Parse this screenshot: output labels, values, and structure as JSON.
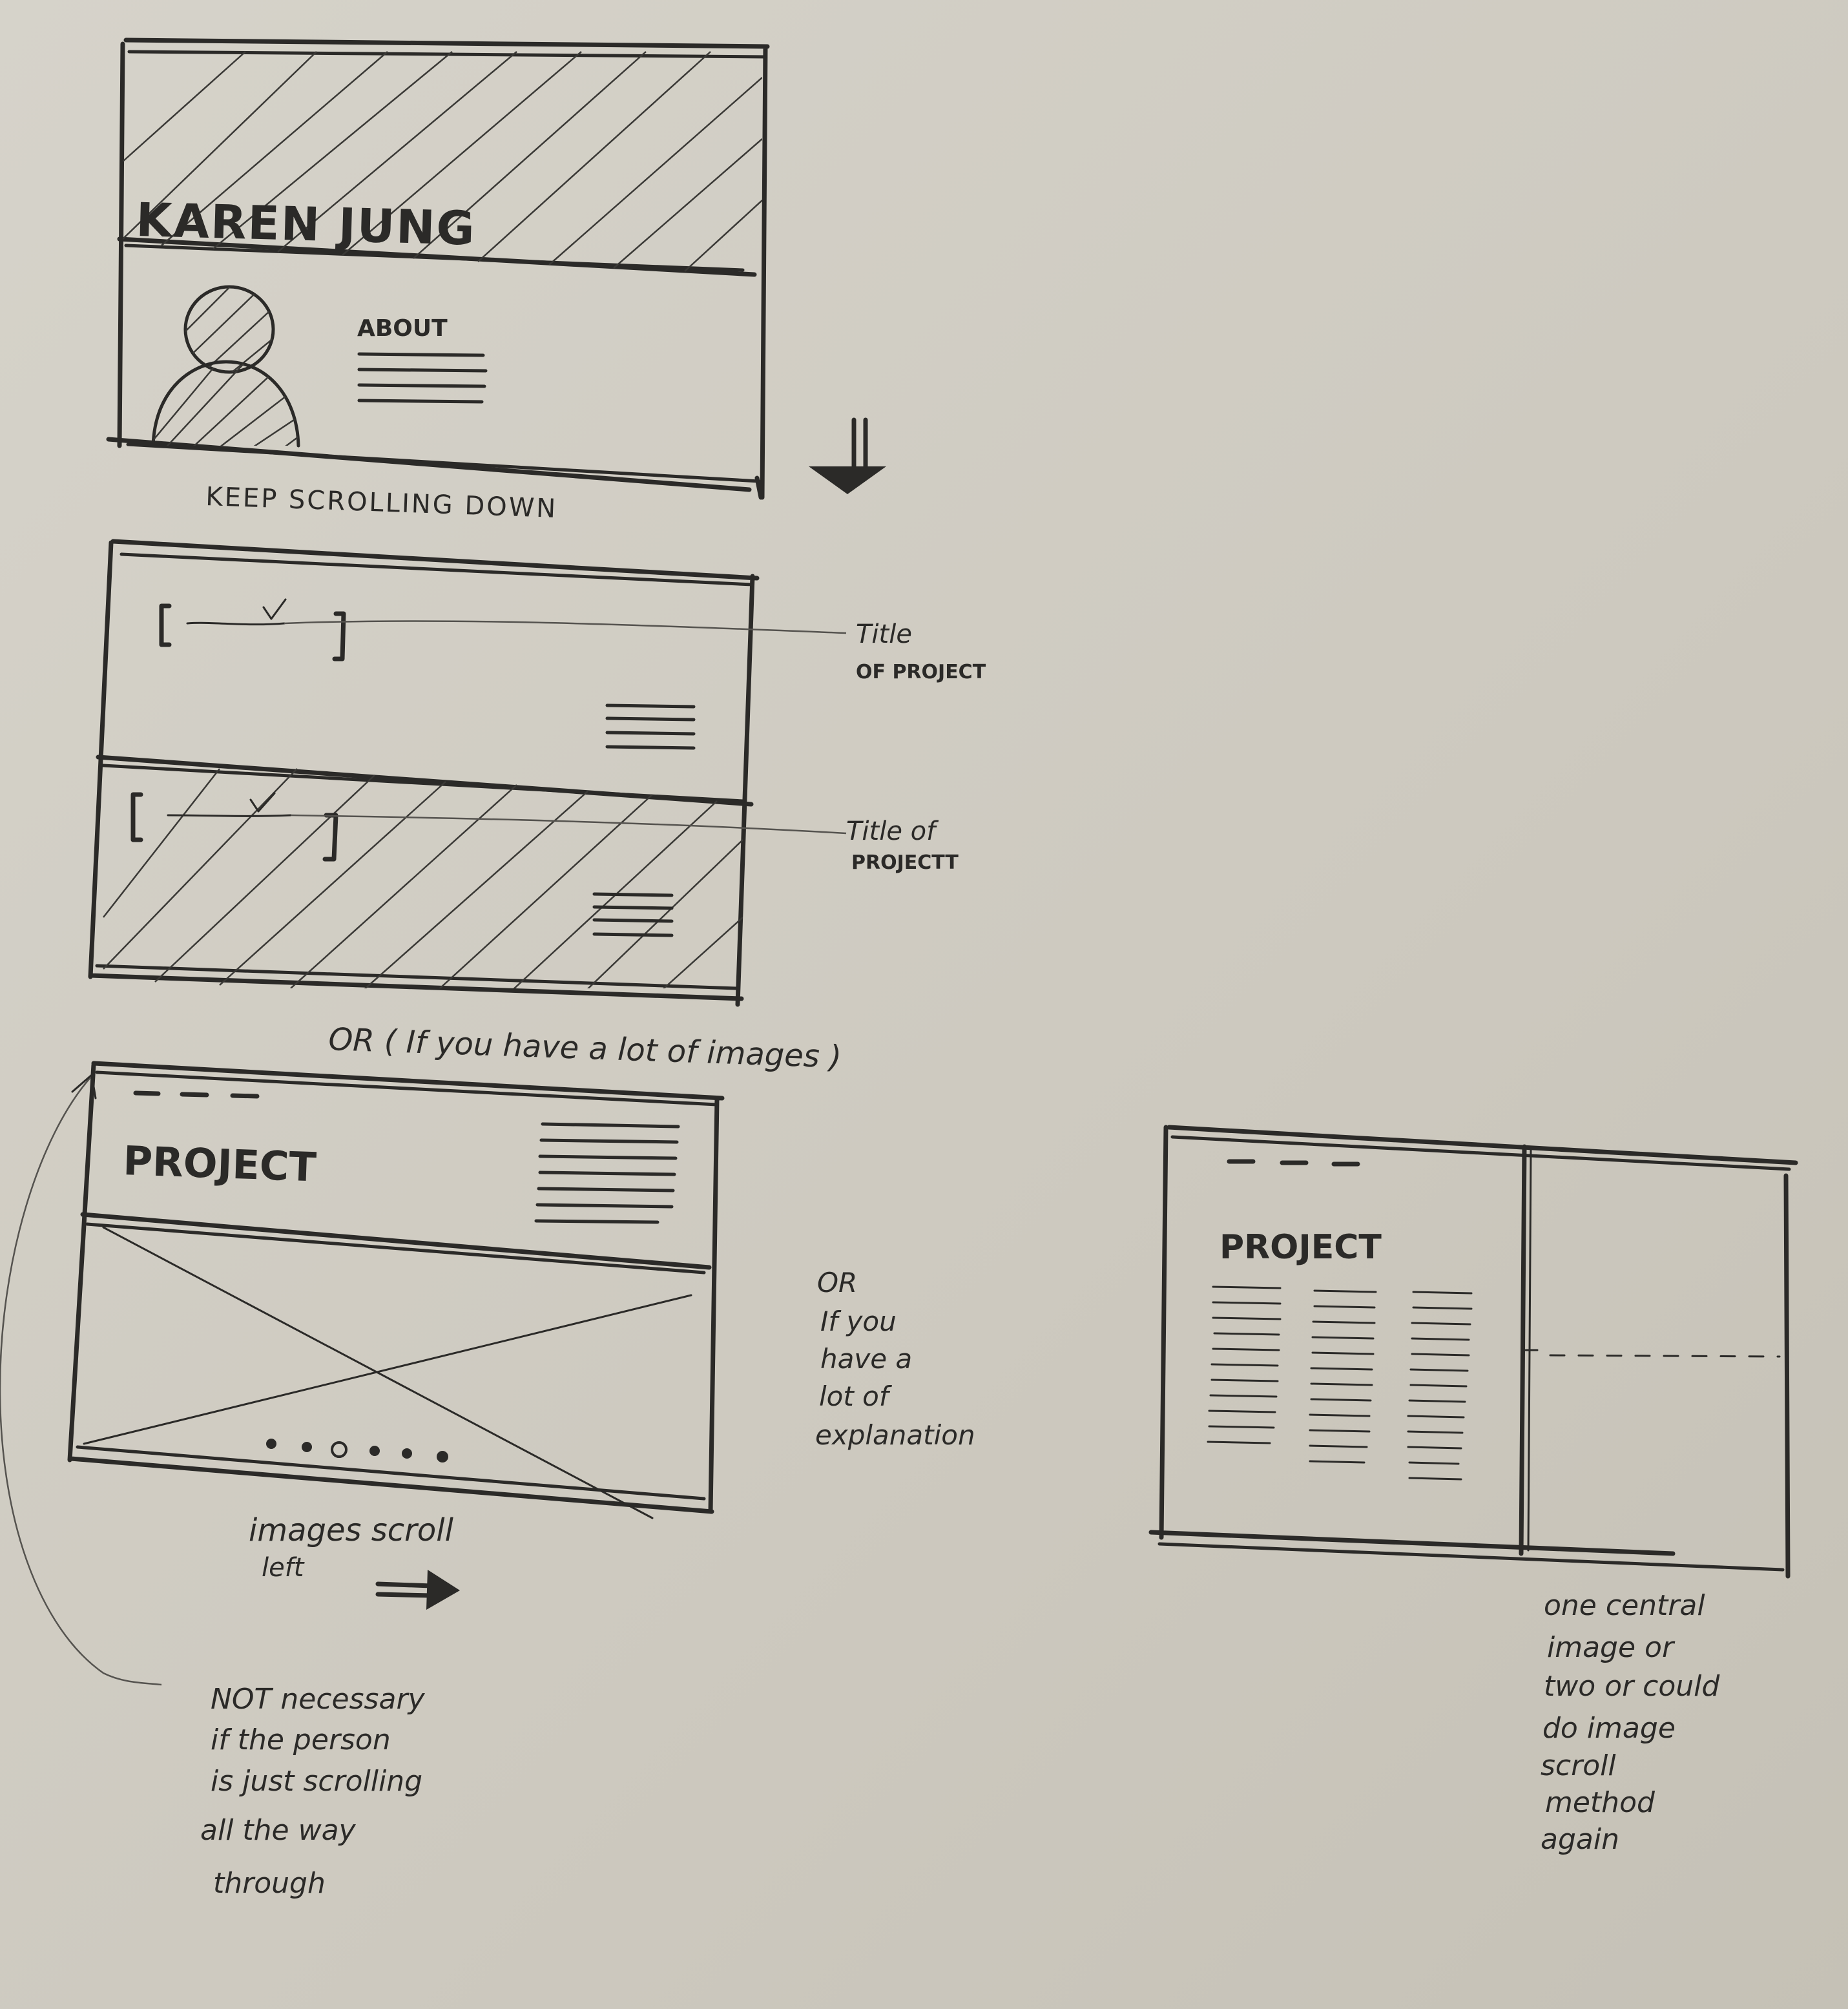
{
  "wireframe_1": {
    "title": "KAREN JUNG",
    "about_label": "ABOUT",
    "caption": "KEEP SCROLLING DOWN"
  },
  "wireframe_2": {
    "annotation_top": [
      "Title",
      "OF PROJECT"
    ],
    "annotation_bottom": [
      "Title of",
      "PROJECTT"
    ]
  },
  "wireframe_3": {
    "intro": "OR ( If you have a lot of images )",
    "title": "PROJECT",
    "caption": [
      "images scroll",
      "left"
    ],
    "side_note": [
      "NOT necessary",
      "if the person",
      "is just scrolling",
      "all the way",
      "through"
    ]
  },
  "middle_note": [
    "OR",
    "If you",
    "have a",
    "lot of",
    "explanation"
  ],
  "wireframe_4": {
    "title": "PROJECT",
    "caption": [
      "one central",
      "image or",
      "two or could",
      "do image",
      "scroll",
      "method",
      "again"
    ]
  },
  "ink_color": "#2b2a28",
  "paper_color": "#cfcbc1"
}
